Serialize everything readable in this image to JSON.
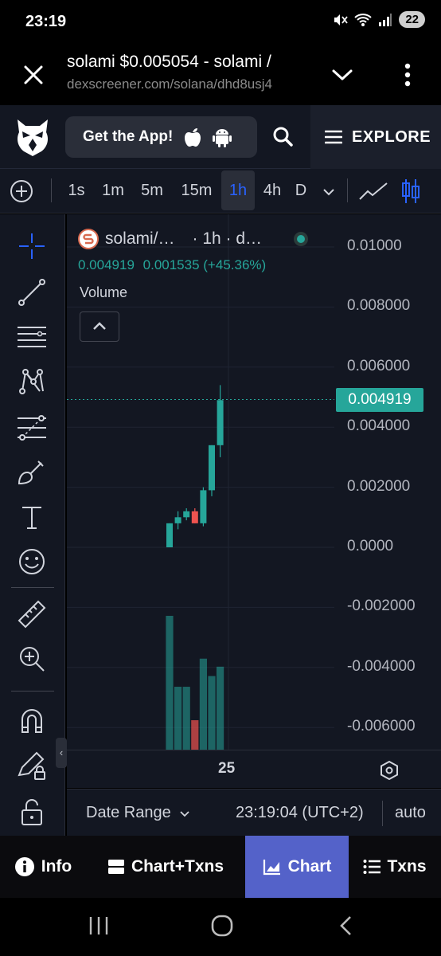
{
  "status": {
    "time": "23:19",
    "battery": "22"
  },
  "browser": {
    "title": "solami $0.005054 - solami /",
    "url": "dexscreener.com/solana/dhd8usj4"
  },
  "header": {
    "get_app": "Get the App!",
    "explore": "EXPLORE"
  },
  "timeframes": [
    {
      "label": "1s",
      "active": false
    },
    {
      "label": "1m",
      "active": false
    },
    {
      "label": "5m",
      "active": false
    },
    {
      "label": "15m",
      "active": false
    },
    {
      "label": "1h",
      "active": true
    },
    {
      "label": "4h",
      "active": false
    },
    {
      "label": "D",
      "active": false
    }
  ],
  "left_tools": [
    "crosshair-icon",
    "trend-line-icon",
    "horizontal-lines-icon",
    "pattern-icon",
    "fib-retracement-icon",
    "brush-icon",
    "text-icon",
    "emoji-icon",
    "ruler-icon",
    "zoom-in-icon",
    "magnet-icon",
    "pencil-lock-icon",
    "unlock-icon"
  ],
  "legend": {
    "pair": "solami/…",
    "interval": "· 1h · d…",
    "price": "0.004919",
    "change": "0.001535 (+45.36%)",
    "volume_label": "Volume"
  },
  "chart_data": {
    "type": "candlestick",
    "y_ticks": [
      "0.01000",
      "0.008000",
      "0.006000",
      "0.004000",
      "0.002000",
      "0.0000",
      "-0.002000",
      "-0.004000",
      "-0.006000"
    ],
    "last_price": "0.004919",
    "x_tick": "25",
    "candles": [
      {
        "open": 0.0,
        "high": 0.0008,
        "low": 0.0,
        "close": 0.0008,
        "dir": "up"
      },
      {
        "open": 0.0008,
        "high": 0.0012,
        "low": 0.0006,
        "close": 0.001,
        "dir": "up"
      },
      {
        "open": 0.001,
        "high": 0.0013,
        "low": 0.0009,
        "close": 0.0012,
        "dir": "up"
      },
      {
        "open": 0.0012,
        "high": 0.0013,
        "low": 0.0008,
        "close": 0.0008,
        "dir": "down"
      },
      {
        "open": 0.0008,
        "high": 0.002,
        "low": 0.0007,
        "close": 0.0019,
        "dir": "up"
      },
      {
        "open": 0.0019,
        "high": 0.0034,
        "low": 0.0017,
        "close": 0.0034,
        "dir": "up"
      },
      {
        "open": 0.0034,
        "high": 0.0054,
        "low": 0.003,
        "close": 0.0049,
        "dir": "up"
      }
    ],
    "volumes": [
      {
        "value": 1.0,
        "dir": "up"
      },
      {
        "value": 0.47,
        "dir": "up"
      },
      {
        "value": 0.47,
        "dir": "up"
      },
      {
        "value": 0.22,
        "dir": "down"
      },
      {
        "value": 0.68,
        "dir": "up"
      },
      {
        "value": 0.55,
        "dir": "up"
      },
      {
        "value": 0.62,
        "dir": "up"
      }
    ]
  },
  "bottom": {
    "date_range": "Date Range",
    "clock": "23:19:04 (UTC+2)",
    "auto": "auto"
  },
  "nav_tabs": [
    {
      "label": "Info",
      "icon": "info-icon",
      "active": false
    },
    {
      "label": "Chart+Txns",
      "icon": "split-view-icon",
      "active": false
    },
    {
      "label": "Chart",
      "icon": "chart-icon",
      "active": true
    },
    {
      "label": "Txns",
      "icon": "list-icon",
      "active": false
    }
  ],
  "colors": {
    "up": "#26a69a",
    "down": "#ef5350",
    "accent": "#2962ff",
    "tab_active": "#5462c9"
  }
}
